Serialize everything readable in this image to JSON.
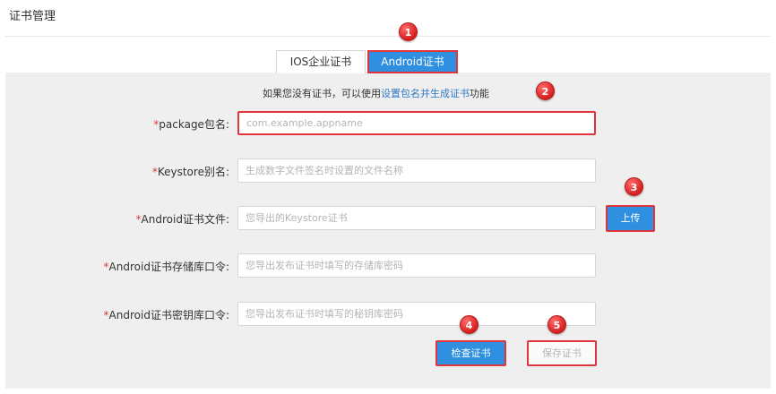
{
  "page": {
    "title": "证书管理"
  },
  "tabs": [
    {
      "label": "IOS企业证书",
      "active": false
    },
    {
      "label": "Android证书",
      "active": true
    }
  ],
  "hint": {
    "prefix": "如果您没有证书，可以使用",
    "link": "设置包名并生成证书",
    "suffix": "功能"
  },
  "form": {
    "required_mark": "*",
    "fields": [
      {
        "label": "package包名:",
        "value": "",
        "placeholder": "com.example.appname"
      },
      {
        "label": "Keystore别名:",
        "value": "",
        "placeholder": "生成数字文件签名时设置的文件名称"
      },
      {
        "label": "Android证书文件:",
        "value": "",
        "placeholder": "您导出的Keystore证书"
      },
      {
        "label": "Android证书存储库口令:",
        "value": "",
        "placeholder": "您导出发布证书时填写的存储库密码"
      },
      {
        "label": "Android证书密钥库口令:",
        "value": "",
        "placeholder": "您导出发布证书时填写的秘钥库密码"
      }
    ]
  },
  "buttons": {
    "upload": "上传",
    "check": "检查证书",
    "save": "保存证书"
  },
  "badges": [
    "1",
    "2",
    "3",
    "4",
    "5"
  ],
  "colors": {
    "accent": "#2f8fe0",
    "highlight": "#e0353a",
    "required": "#e0353a",
    "link": "#2f78c7",
    "panel_bg": "#efefef"
  }
}
